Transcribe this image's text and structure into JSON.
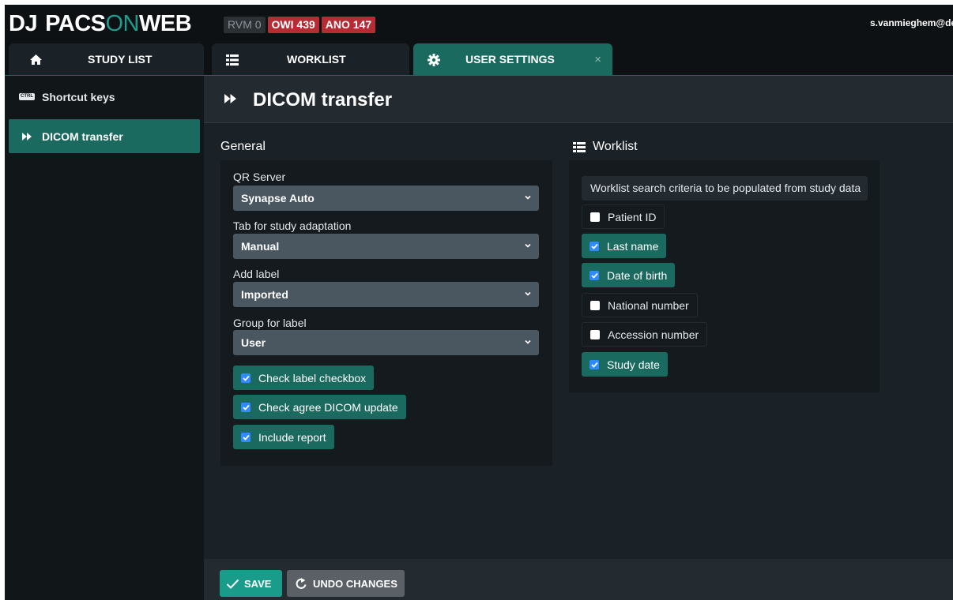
{
  "header": {
    "logo": {
      "dj": "DJ",
      "pacs": "PACS",
      "on": "ON",
      "web": "WEB"
    },
    "badges": [
      "RVM 0",
      "OWI 439",
      "ANO 147"
    ],
    "user": "s.vanmieghem@de"
  },
  "tabs": [
    {
      "label": "STUDY LIST",
      "icon": "home-icon"
    },
    {
      "label": "WORKLIST",
      "icon": "list-icon"
    },
    {
      "label": "USER SETTINGS",
      "icon": "gear-icon",
      "close": "×"
    }
  ],
  "sidebar": {
    "items": [
      {
        "label": "Shortcut keys",
        "icon": "ctrl-key-icon",
        "icon_text": "CTRL"
      },
      {
        "label": "DICOM transfer",
        "icon": "fast-forward-icon"
      }
    ]
  },
  "page": {
    "title": "DICOM transfer"
  },
  "general": {
    "title": "General",
    "fields": [
      {
        "label": "QR Server",
        "value": "Synapse Auto"
      },
      {
        "label": "Tab for study adaptation",
        "value": "Manual"
      },
      {
        "label": "Add label",
        "value": "Imported"
      },
      {
        "label": "Group for label",
        "value": "User"
      }
    ],
    "checks": [
      {
        "label": "Check label checkbox",
        "checked": true
      },
      {
        "label": "Check agree DICOM update",
        "checked": true
      },
      {
        "label": "Include report",
        "checked": true
      }
    ]
  },
  "worklist": {
    "title": "Worklist",
    "hint": "Worklist search criteria to be populated from study data",
    "checks": [
      {
        "label": "Patient ID",
        "checked": false
      },
      {
        "label": "Last name",
        "checked": true
      },
      {
        "label": "Date of birth",
        "checked": true
      },
      {
        "label": "National number",
        "checked": false
      },
      {
        "label": "Accession number",
        "checked": false
      },
      {
        "label": "Study date",
        "checked": true
      }
    ]
  },
  "footer": {
    "save": "SAVE",
    "undo": "UNDO CHANGES"
  },
  "colors": {
    "accent": "#1a6a5f",
    "danger": "#b52c35",
    "checkbox": "#2f8bff"
  }
}
